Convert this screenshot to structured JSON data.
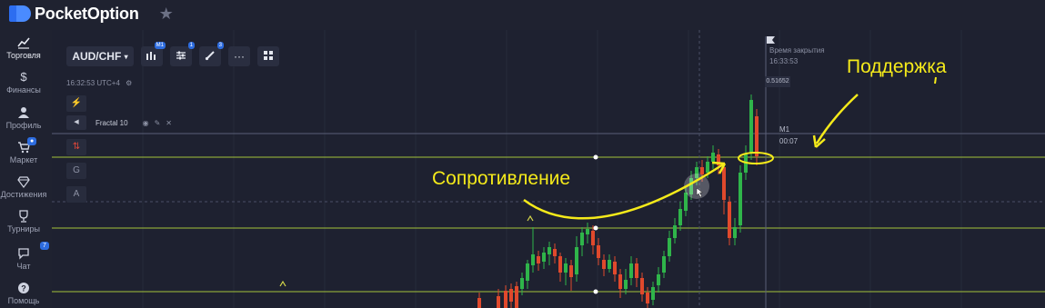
{
  "app": {
    "name": "PocketOption"
  },
  "sidebar": {
    "items": [
      {
        "label": "Торговля",
        "icon": "chart-icon"
      },
      {
        "label": "Финансы",
        "icon": "dollar-icon"
      },
      {
        "label": "Профиль",
        "icon": "user-icon"
      },
      {
        "label": "Маркет",
        "icon": "cart-icon"
      },
      {
        "label": "Достижения",
        "icon": "diamond-icon"
      },
      {
        "label": "Турниры",
        "icon": "trophy-icon"
      },
      {
        "label": "Чат",
        "icon": "chat-icon",
        "badge": "7"
      },
      {
        "label": "Помощь",
        "icon": "help-icon"
      }
    ]
  },
  "toolbar": {
    "pair": "AUD/CHF",
    "timeframe_badge": "M1",
    "indicators_badge": "1",
    "drawings_badge": "3"
  },
  "chart": {
    "time": "16:32:53 UTC+4",
    "indicator": "Fractal 10",
    "tools": [
      "⚡",
      "⇅",
      "G",
      "A"
    ],
    "close_time_label": "Время закрытия",
    "close_time": "16:33:53",
    "price": "0.51652",
    "timeframe": "M1",
    "countdown": "00:07"
  },
  "annotations": {
    "resistance": "Сопротивление",
    "support": "Поддержка"
  },
  "colors": {
    "background": "#1e2130",
    "level_line": "#a4c43a",
    "bull": "#2fb54a",
    "bear": "#e0492c",
    "annotation": "#f5ea1a"
  }
}
